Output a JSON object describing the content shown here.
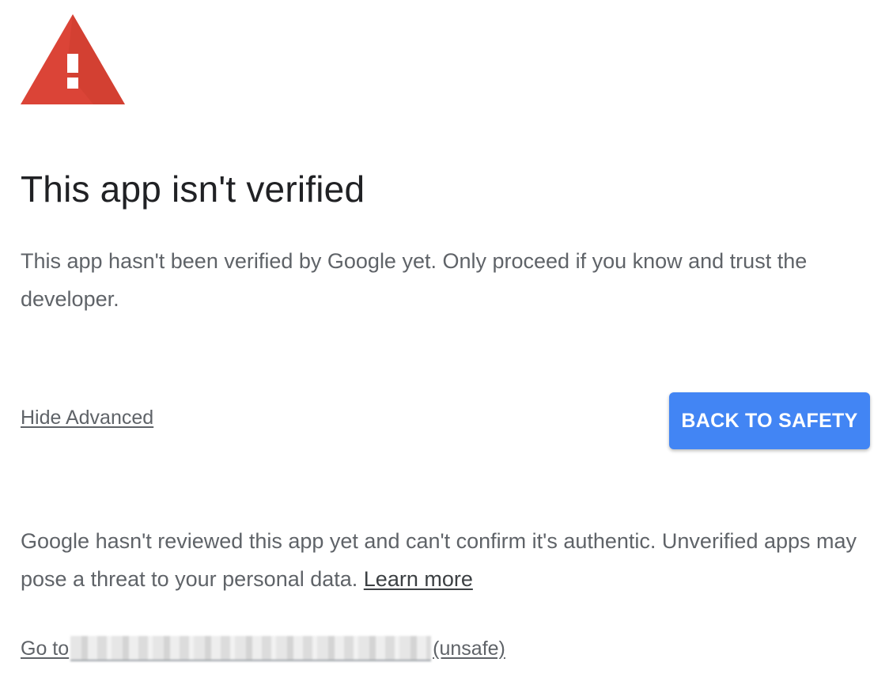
{
  "colors": {
    "warning_red": "#db4437",
    "accent_blue": "#4285f4",
    "title_text": "#202124",
    "body_text": "#5f6368"
  },
  "icons": {
    "warning": "warning-triangle-icon"
  },
  "title": "This app isn't verified",
  "description": "This app hasn't been verified by Google yet. Only proceed if you know and trust the developer.",
  "actions": {
    "hide_advanced_label": "Hide Advanced",
    "back_to_safety_label": "BACK TO SAFETY"
  },
  "advanced": {
    "text": "Google hasn't reviewed this app yet and can't confirm it's authentic. Unverified apps may pose a threat to your personal data. ",
    "learn_more_label": "Learn more",
    "goto_prefix": "Go to",
    "goto_suffix": "(unsafe)"
  }
}
